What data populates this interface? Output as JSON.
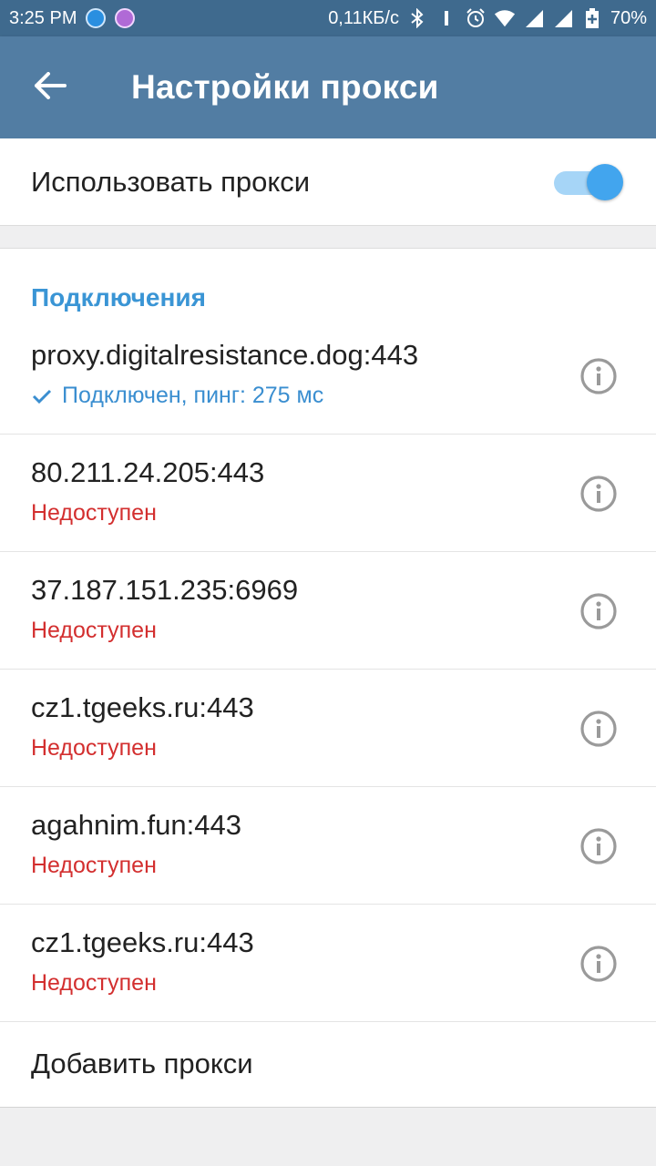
{
  "status_bar": {
    "time": "3:25 PM",
    "speed": "0,11КБ/с",
    "battery": "70%",
    "icons": [
      "app-notification-icon",
      "app-notification-icon-2",
      "bluetooth-icon",
      "vibrate-icon",
      "alarm-icon",
      "wifi-icon",
      "signal-icon",
      "signal-icon-2",
      "battery-icon"
    ]
  },
  "app_bar": {
    "back_icon": "arrow-left-icon",
    "title": "Настройки прокси"
  },
  "use_proxy": {
    "label": "Использовать прокси",
    "enabled": true
  },
  "connections": {
    "header": "Подключения",
    "items": [
      {
        "address": "proxy.digitalresistance.dog:443",
        "status": "Подключен, пинг: 275 мс",
        "state": "connected"
      },
      {
        "address": "80.211.24.205:443",
        "status": "Недоступен",
        "state": "unavailable"
      },
      {
        "address": "37.187.151.235:6969",
        "status": "Недоступен",
        "state": "unavailable"
      },
      {
        "address": "cz1.tgeeks.ru:443",
        "status": "Недоступен",
        "state": "unavailable"
      },
      {
        "address": "agahnim.fun:443",
        "status": "Недоступен",
        "state": "unavailable"
      },
      {
        "address": "cz1.tgeeks.ru:443",
        "status": "Недоступен",
        "state": "unavailable"
      }
    ],
    "add_label": "Добавить прокси"
  },
  "colors": {
    "status_bar": "#3f6a8e",
    "app_bar": "#527da3",
    "accent": "#3a95d5",
    "connected": "#3a8ed0",
    "unavailable": "#d32f2f",
    "toggle_thumb": "#42a5ee",
    "toggle_track": "#a6d5f7"
  }
}
